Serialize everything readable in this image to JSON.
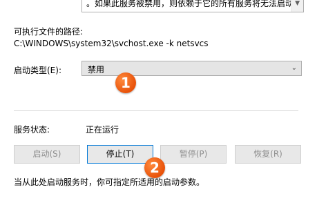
{
  "description": {
    "text": "。如果此服务被禁用，则依赖于它的所有服务将无法启动"
  },
  "path": {
    "label": "可执行文件的路径:",
    "value": "C:\\WINDOWS\\system32\\svchost.exe -k netsvcs"
  },
  "startup": {
    "label": "启动类型(E):",
    "selected": "禁用"
  },
  "status": {
    "label": "服务状态:",
    "value": "正在运行"
  },
  "buttons": {
    "start": "启动(S)",
    "stop": "停止(T)",
    "pause": "暂停(P)",
    "resume": "恢复(R)"
  },
  "hint": "当从此处启动服务时，你可指定所适用的启动参数。",
  "annotations": {
    "badge1": "1",
    "badge2": "2",
    "color": "#f26b1d"
  }
}
